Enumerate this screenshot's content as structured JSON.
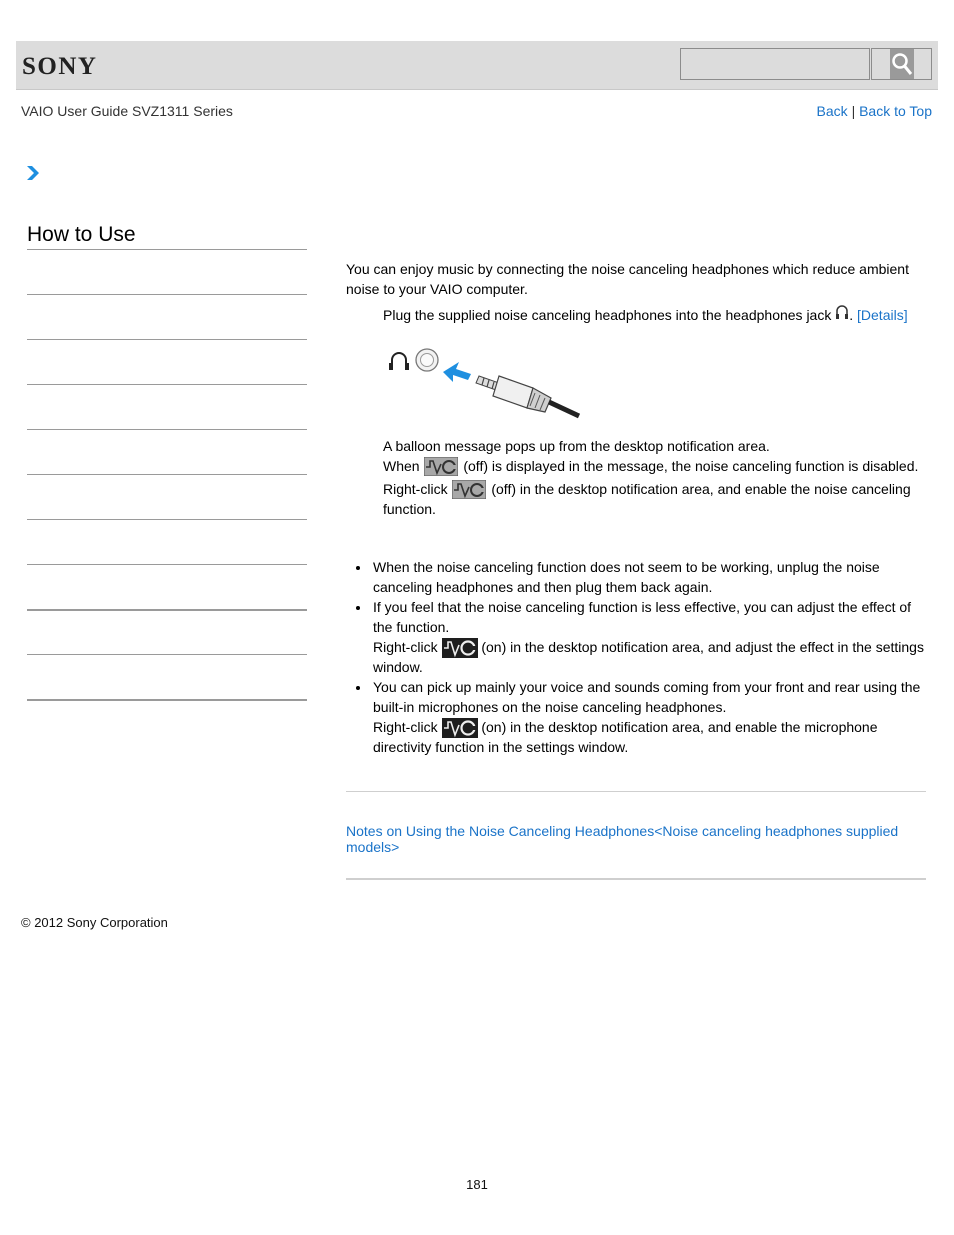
{
  "header": {
    "logo": "SONY",
    "search": {
      "value": "",
      "placeholder": ""
    },
    "search_button_icon": "magnifier-icon"
  },
  "subheader": {
    "guide_title": "VAIO User Guide SVZ1311 Series",
    "links": {
      "back": "Back",
      "separator": "|",
      "back_to_top": "Back to Top"
    }
  },
  "breadcrumb": {
    "icon": "chevron-right-icon"
  },
  "sidebar": {
    "title": "How to Use",
    "items": [
      {
        "label": ""
      },
      {
        "label": ""
      },
      {
        "label": ""
      },
      {
        "label": ""
      },
      {
        "label": ""
      },
      {
        "label": ""
      },
      {
        "label": ""
      },
      {
        "label": ""
      },
      {
        "label": ""
      },
      {
        "label": ""
      }
    ]
  },
  "main": {
    "intro": "You can enjoy music by connecting the noise canceling headphones which reduce ambient noise to your VAIO computer.",
    "step1": {
      "text": "Plug the supplied noise canceling headphones into the headphones jack",
      "icon": "headphones-icon",
      "after": ".",
      "details_link": "[Details]"
    },
    "step2": {
      "line1": "A balloon message pops up from the desktop notification area.",
      "line2_pre": "When",
      "line2_post": "(off) is displayed in the message, the noise canceling function is disabled.",
      "line3_pre": "Right-click",
      "line3_post": "(off) in the desktop notification area, and enable the noise canceling function.",
      "icon_off": "noise-canceling-off-icon"
    },
    "notes": [
      {
        "text": "When the noise canceling function does not seem to be working, unplug the noise canceling headphones and then plug them back again."
      },
      {
        "text": "If you feel that the noise canceling function is less effective, you can adjust the effect of the function.",
        "sub_pre": "Right-click",
        "sub_post": "(on) in the desktop notification area, and adjust the effect in the settings window."
      },
      {
        "text": "You can pick up mainly your voice and sounds coming from your front and rear using the built-in microphones on the noise canceling headphones.",
        "sub_pre": "Right-click",
        "sub_post": "(on) in the desktop notification area, and enable the microphone directivity function in the settings window."
      }
    ],
    "related_link": "Notes on Using the Noise Canceling Headphones<Noise canceling headphones supplied models>"
  },
  "colors": {
    "link": "#1a73c8",
    "header_bg": "#dcdcdc",
    "arrow": "#1e8fe0"
  },
  "footer": {
    "copyright": "© 2012 Sony Corporation",
    "page_number": "181"
  }
}
